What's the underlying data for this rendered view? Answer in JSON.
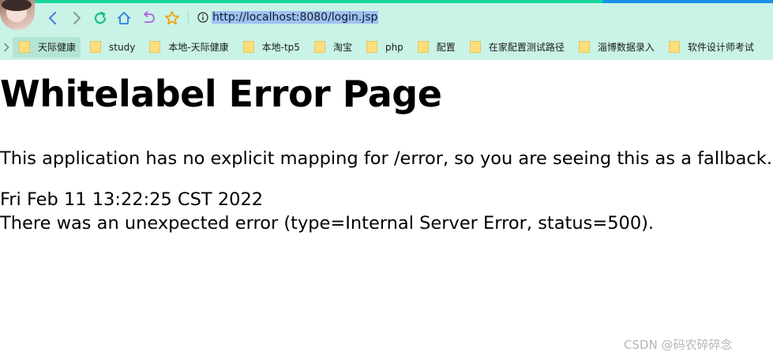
{
  "browser": {
    "url": "http://localhost:8080/login.jsp",
    "bookmarks": [
      {
        "label": "天际健康",
        "active": true
      },
      {
        "label": "study",
        "active": false
      },
      {
        "label": "本地-天际健康",
        "active": false
      },
      {
        "label": "本地-tp5",
        "active": false
      },
      {
        "label": "淘宝",
        "active": false
      },
      {
        "label": "php",
        "active": false
      },
      {
        "label": "配置",
        "active": false
      },
      {
        "label": "在家配置测试路径",
        "active": false
      },
      {
        "label": "淄博数据录入",
        "active": false
      },
      {
        "label": "软件设计师考试",
        "active": false
      }
    ],
    "icons": {
      "back": "back-arrow-icon",
      "forward": "forward-arrow-icon",
      "reload": "reload-icon",
      "home": "home-icon",
      "undo": "undo-icon",
      "favorite": "star-icon",
      "info": "info-icon"
    }
  },
  "page": {
    "title": "Whitelabel Error Page",
    "message": "This application has no explicit mapping for /error, so you are seeing this as a fallback.",
    "timestamp": "Fri Feb 11 13:22:25 CST 2022",
    "error_detail": "There was an unexpected error (type=Internal Server Error, status=500)."
  },
  "watermark": "CSDN @码农碎碎念",
  "colors": {
    "toolbar_bg": "#c9f3e6",
    "url_highlight": "#9fc0f2",
    "accent_green": "#19d59b",
    "accent_blue": "#1b8fe8"
  }
}
